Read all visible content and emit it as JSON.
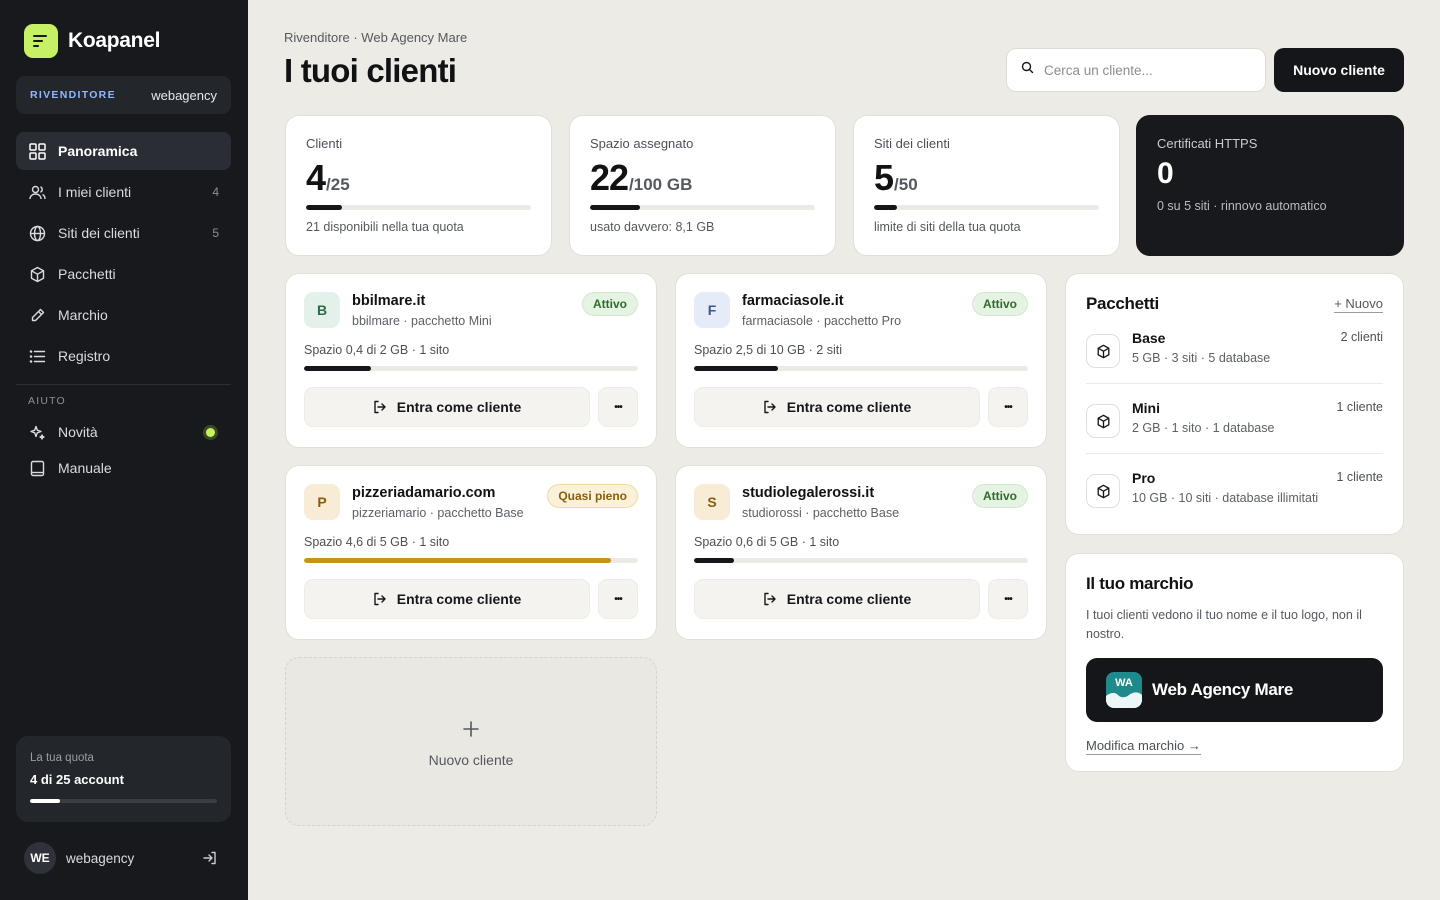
{
  "app": {
    "name": "Koapanel",
    "accent": "#c6f164"
  },
  "sidebar": {
    "reseller_role": "RIVENDITORE",
    "reseller_name": "webagency",
    "nav": [
      {
        "label": "Panoramica",
        "icon": "grid-icon",
        "count": "",
        "active": true
      },
      {
        "label": "I miei clienti",
        "icon": "users-icon",
        "count": "4"
      },
      {
        "label": "Siti dei clienti",
        "icon": "globe-icon",
        "count": "5"
      },
      {
        "label": "Pacchetti",
        "icon": "cube-icon",
        "count": ""
      },
      {
        "label": "Marchio",
        "icon": "brush-icon",
        "count": ""
      },
      {
        "label": "Registro",
        "icon": "list-icon",
        "count": ""
      }
    ],
    "help_label": "AIUTO",
    "help": [
      {
        "label": "Novità",
        "icon": "sparkle-icon"
      },
      {
        "label": "Manuale",
        "icon": "book-icon"
      }
    ],
    "quota": {
      "label": "La tua quota",
      "value": "4 di 25 account",
      "used": 4,
      "total": 25
    },
    "user": {
      "initials": "WE",
      "name": "webagency"
    }
  },
  "header": {
    "breadcrumb": "Rivenditore · Web Agency Mare",
    "title": "I tuoi clienti",
    "search_placeholder": "Cerca un cliente...",
    "new_client_label": "Nuovo cliente"
  },
  "stats": [
    {
      "label": "Clienti",
      "value": "4",
      "denominator": "/25",
      "fraction": 0.16,
      "note": "21 disponibili nella tua quota"
    },
    {
      "label": "Spazio assegnato",
      "value": "22",
      "denominator": "/100 GB",
      "fraction": 0.22,
      "note": "usato davvero: 8,1 GB"
    },
    {
      "label": "Siti dei clienti",
      "value": "5",
      "denominator": "/50",
      "fraction": 0.1,
      "note": "limite di siti della tua quota"
    },
    {
      "label": "Certificati HTTPS",
      "value": "0",
      "denominator": "",
      "note": "0 su 5 siti · rinnovo automatico"
    }
  ],
  "clients": [
    {
      "initial": "B",
      "domain": "bbilmare.it",
      "sub": "bbilmare · pacchetto Mini",
      "status": "Attivo",
      "status_type": "ok",
      "space": "Spazio 0,4 di 2 GB · 1 sito",
      "fraction": 0.2,
      "color": "#e3f1ea",
      "text_color": "#2f6b4a"
    },
    {
      "initial": "F",
      "domain": "farmaciasole.it",
      "sub": "farmaciasole · pacchetto Pro",
      "status": "Attivo",
      "status_type": "ok",
      "space": "Spazio 2,5 di 10 GB · 2 siti",
      "fraction": 0.25,
      "color": "#e6ebf8",
      "text_color": "#3a559a"
    },
    {
      "initial": "P",
      "domain": "pizzeriadamario.com",
      "sub": "pizzeriamario · pacchetto Base",
      "status": "Quasi pieno",
      "status_type": "warn",
      "space": "Spazio 4,6 di 5 GB · 1 sito",
      "fraction": 0.92,
      "color": "#f8ecd6",
      "text_color": "#8a5d0c"
    },
    {
      "initial": "S",
      "domain": "studiolegalerossi.it",
      "sub": "studiorossi · pacchetto Base",
      "status": "Attivo",
      "status_type": "ok",
      "space": "Spazio 0,6 di 5 GB · 1 sito",
      "fraction": 0.12,
      "color": "#f8ecd6",
      "text_color": "#8a5d0c"
    }
  ],
  "client_action_label": "Entra come cliente",
  "client_more_label": "•••",
  "add_client_label": "Nuovo cliente",
  "packages": {
    "title": "Pacchetti",
    "new_label": "+ Nuovo",
    "items": [
      {
        "name": "Base",
        "desc": "5 GB · 3 siti · 5 database",
        "count": "2 clienti"
      },
      {
        "name": "Mini",
        "desc": "2 GB · 1 sito · 1 database",
        "count": "1 cliente"
      },
      {
        "name": "Pro",
        "desc": "10 GB · 10 siti · database illimitati",
        "count": "1 cliente"
      }
    ]
  },
  "brand": {
    "title": "Il tuo marchio",
    "desc": "I tuoi clienti vedono il tuo nome e il tuo logo, non il nostro.",
    "logo_text": "WA",
    "logo_color": "#1f8a8c",
    "name": "Web Agency Mare",
    "edit_label": "Modifica marchio →"
  }
}
